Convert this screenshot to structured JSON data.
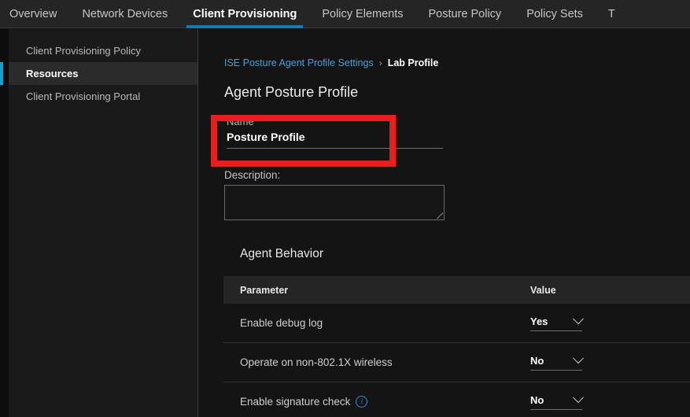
{
  "topnav": {
    "tabs": [
      {
        "label": "Overview",
        "active": false
      },
      {
        "label": "Network Devices",
        "active": false
      },
      {
        "label": "Client Provisioning",
        "active": true
      },
      {
        "label": "Policy Elements",
        "active": false
      },
      {
        "label": "Posture Policy",
        "active": false
      },
      {
        "label": "Policy Sets",
        "active": false
      },
      {
        "label": "T",
        "active": false
      }
    ],
    "active_accent": "#0f7cb8"
  },
  "sidebar": {
    "items": [
      {
        "label": "Client Provisioning Policy",
        "selected": false
      },
      {
        "label": "Resources",
        "selected": true
      },
      {
        "label": "Client Provisioning Portal",
        "selected": false
      }
    ],
    "selected_accent": "#12a0d5"
  },
  "breadcrumb": {
    "parent": "ISE Posture Agent Profile Settings",
    "separator": "›",
    "current": "Lab Profile"
  },
  "page": {
    "title": "Agent Posture Profile"
  },
  "name_field": {
    "label": "Name",
    "required_marker": "*",
    "value": "Posture Profile",
    "highlight_color": "#ee1d1d"
  },
  "description_field": {
    "label": "Description:",
    "value": "",
    "placeholder": ""
  },
  "agent_behavior": {
    "title": "Agent Behavior",
    "columns": [
      "Parameter",
      "Value"
    ],
    "rows": [
      {
        "parameter": "Enable debug log",
        "value": "Yes",
        "has_info": false
      },
      {
        "parameter": "Operate on non-802.1X wireless",
        "value": "No",
        "has_info": false
      },
      {
        "parameter": "Enable signature check",
        "value": "No",
        "has_info": true,
        "info_glyph": "i"
      }
    ]
  }
}
